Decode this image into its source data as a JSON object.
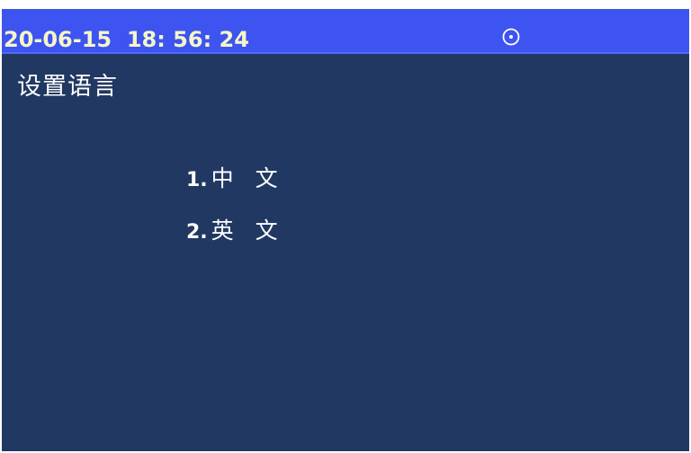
{
  "status_bar": {
    "datetime": "20-06-15  18: 56: 24",
    "icon": "target-circle-icon"
  },
  "page_title": "设置语言",
  "menu": {
    "items": [
      {
        "number": "1.",
        "label": "中 文"
      },
      {
        "number": "2.",
        "label": "英 文"
      }
    ]
  },
  "colors": {
    "background": "#213862",
    "status_bar": "#3d54f0",
    "datetime_text": "#f5f6c8",
    "text": "#ffffff"
  }
}
